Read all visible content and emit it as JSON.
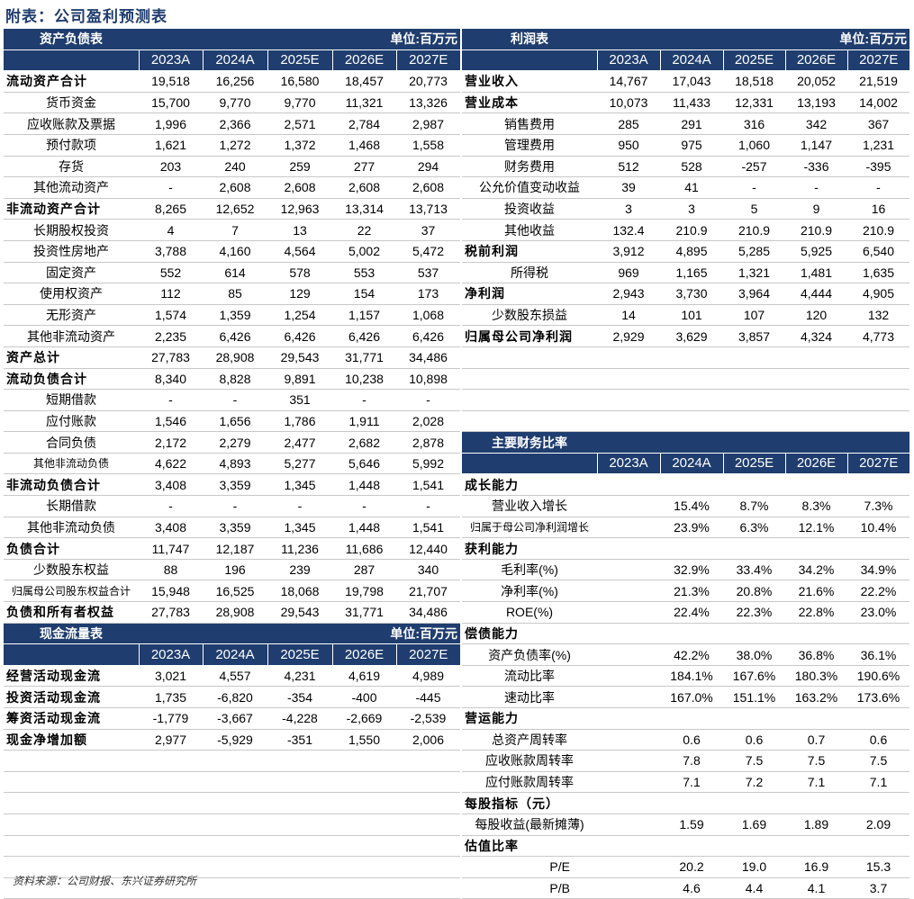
{
  "title": "附表：公司盈利预测表",
  "source": "资料来源：公司财报、东兴证券研究所",
  "balance": {
    "header": "资产负债表",
    "unit": "单位:百万元",
    "years": [
      "2023A",
      "2024A",
      "2025E",
      "2026E",
      "2027E"
    ],
    "rows": [
      {
        "label": "流动资产合计",
        "style": "bold",
        "values": [
          "19,518",
          "16,256",
          "16,580",
          "18,457",
          "20,773"
        ]
      },
      {
        "label": "货币资金",
        "style": "sub",
        "values": [
          "15,700",
          "9,770",
          "9,770",
          "11,321",
          "13,326"
        ]
      },
      {
        "label": "应收账款及票据",
        "style": "sub",
        "values": [
          "1,996",
          "2,366",
          "2,571",
          "2,784",
          "2,987"
        ]
      },
      {
        "label": "预付款项",
        "style": "sub",
        "values": [
          "1,621",
          "1,272",
          "1,372",
          "1,468",
          "1,558"
        ]
      },
      {
        "label": "存货",
        "style": "sub",
        "values": [
          "203",
          "240",
          "259",
          "277",
          "294"
        ]
      },
      {
        "label": "其他流动资产",
        "style": "sub",
        "values": [
          "-",
          "2,608",
          "2,608",
          "2,608",
          "2,608"
        ]
      },
      {
        "label": "非流动资产合计",
        "style": "bold",
        "values": [
          "8,265",
          "12,652",
          "12,963",
          "13,314",
          "13,713"
        ]
      },
      {
        "label": "长期股权投资",
        "style": "sub",
        "values": [
          "4",
          "7",
          "13",
          "22",
          "37"
        ]
      },
      {
        "label": "投资性房地产",
        "style": "sub",
        "values": [
          "3,788",
          "4,160",
          "4,564",
          "5,002",
          "5,472"
        ]
      },
      {
        "label": "固定资产",
        "style": "sub",
        "values": [
          "552",
          "614",
          "578",
          "553",
          "537"
        ]
      },
      {
        "label": "使用权资产",
        "style": "sub",
        "values": [
          "112",
          "85",
          "129",
          "154",
          "173"
        ]
      },
      {
        "label": "无形资产",
        "style": "sub",
        "values": [
          "1,574",
          "1,359",
          "1,254",
          "1,157",
          "1,068"
        ]
      },
      {
        "label": "其他非流动资产",
        "style": "sub",
        "values": [
          "2,235",
          "6,426",
          "6,426",
          "6,426",
          "6,426"
        ]
      },
      {
        "label": "资产总计",
        "style": "bold",
        "values": [
          "27,783",
          "28,908",
          "29,543",
          "31,771",
          "34,486"
        ]
      },
      {
        "label": "流动负债合计",
        "style": "bold",
        "values": [
          "8,340",
          "8,828",
          "9,891",
          "10,238",
          "10,898"
        ]
      },
      {
        "label": "短期借款",
        "style": "sub",
        "values": [
          "-",
          "-",
          "351",
          "-",
          "-"
        ]
      },
      {
        "label": "应付账款",
        "style": "sub",
        "values": [
          "1,546",
          "1,656",
          "1,786",
          "1,911",
          "2,028"
        ]
      },
      {
        "label": "合同负债",
        "style": "sub",
        "values": [
          "2,172",
          "2,279",
          "2,477",
          "2,682",
          "2,878"
        ]
      },
      {
        "label": "其他非流动负债",
        "style": "sub small",
        "values": [
          "4,622",
          "4,893",
          "5,277",
          "5,646",
          "5,992"
        ]
      },
      {
        "label": "非流动负债合计",
        "style": "bold",
        "values": [
          "3,408",
          "3,359",
          "1,345",
          "1,448",
          "1,541"
        ]
      },
      {
        "label": "长期借款",
        "style": "sub",
        "values": [
          "-",
          "-",
          "-",
          "-",
          "-"
        ]
      },
      {
        "label": "其他非流动负债",
        "style": "sub",
        "values": [
          "3,408",
          "3,359",
          "1,345",
          "1,448",
          "1,541"
        ]
      },
      {
        "label": "负债合计",
        "style": "bold",
        "values": [
          "11,747",
          "12,187",
          "11,236",
          "11,686",
          "12,440"
        ]
      },
      {
        "label": "少数股东权益",
        "style": "sub",
        "values": [
          "88",
          "196",
          "239",
          "287",
          "340"
        ]
      },
      {
        "label": "归属母公司股东权益合计",
        "style": "sub small",
        "values": [
          "15,948",
          "16,525",
          "18,068",
          "19,798",
          "21,707"
        ]
      },
      {
        "label": "负债和所有者权益",
        "style": "bold",
        "values": [
          "27,783",
          "28,908",
          "29,543",
          "31,771",
          "34,486"
        ]
      }
    ]
  },
  "cashflow": {
    "header": "现金流量表",
    "unit": "单位:百万元",
    "years": [
      "2023A",
      "2024A",
      "2025E",
      "2026E",
      "2027E"
    ],
    "rows": [
      {
        "label": "经营活动现金流",
        "style": "bold",
        "values": [
          "3,021",
          "4,557",
          "4,231",
          "4,619",
          "4,989"
        ]
      },
      {
        "label": "投资活动现金流",
        "style": "bold",
        "values": [
          "1,735",
          "-6,820",
          "-354",
          "-400",
          "-445"
        ]
      },
      {
        "label": "筹资活动现金流",
        "style": "bold",
        "values": [
          "-1,779",
          "-3,667",
          "-4,228",
          "-2,669",
          "-2,539"
        ]
      },
      {
        "label": "现金净增加额",
        "style": "bold",
        "values": [
          "2,977",
          "-5,929",
          "-351",
          "1,550",
          "2,006"
        ]
      }
    ]
  },
  "income": {
    "header": "利润表",
    "unit": "单位:百万元",
    "years": [
      "2023A",
      "2024A",
      "2025E",
      "2026E",
      "2027E"
    ],
    "rows": [
      {
        "label": "营业收入",
        "style": "bold",
        "values": [
          "14,767",
          "17,043",
          "18,518",
          "20,052",
          "21,519"
        ]
      },
      {
        "label": "营业成本",
        "style": "bold",
        "values": [
          "10,073",
          "11,433",
          "12,331",
          "13,193",
          "14,002"
        ]
      },
      {
        "label": "销售费用",
        "style": "sub",
        "values": [
          "285",
          "291",
          "316",
          "342",
          "367"
        ]
      },
      {
        "label": "管理费用",
        "style": "sub",
        "values": [
          "950",
          "975",
          "1,060",
          "1,147",
          "1,231"
        ]
      },
      {
        "label": "财务费用",
        "style": "sub",
        "values": [
          "512",
          "528",
          "-257",
          "-336",
          "-395"
        ]
      },
      {
        "label": "公允价值变动收益",
        "style": "sub",
        "values": [
          "39",
          "41",
          "-",
          "-",
          "-"
        ]
      },
      {
        "label": "投资收益",
        "style": "sub",
        "values": [
          "3",
          "3",
          "5",
          "9",
          "16"
        ]
      },
      {
        "label": "其他收益",
        "style": "sub",
        "values": [
          "132.4",
          "210.9",
          "210.9",
          "210.9",
          "210.9"
        ]
      },
      {
        "label": "税前利润",
        "style": "bold",
        "values": [
          "3,912",
          "4,895",
          "5,285",
          "5,925",
          "6,540"
        ]
      },
      {
        "label": "所得税",
        "style": "sub",
        "values": [
          "969",
          "1,165",
          "1,321",
          "1,481",
          "1,635"
        ]
      },
      {
        "label": "净利润",
        "style": "bold",
        "values": [
          "2,943",
          "3,730",
          "3,964",
          "4,444",
          "4,905"
        ]
      },
      {
        "label": "少数股东损益",
        "style": "sub",
        "values": [
          "14",
          "101",
          "107",
          "120",
          "132"
        ]
      },
      {
        "label": "归属母公司净利润",
        "style": "bold",
        "values": [
          "2,929",
          "3,629",
          "3,857",
          "4,324",
          "4,773"
        ]
      }
    ]
  },
  "ratios": {
    "header": "主要财务比率",
    "years": [
      "2023A",
      "2024A",
      "2025E",
      "2026E",
      "2027E"
    ],
    "rows": [
      {
        "label": "成长能力",
        "style": "bold",
        "values": [
          "",
          "",
          "",
          "",
          ""
        ]
      },
      {
        "label": "营业收入增长",
        "style": "sub",
        "values": [
          "",
          "15.4%",
          "8.7%",
          "8.3%",
          "7.3%"
        ]
      },
      {
        "label": "归属于母公司净利润增长",
        "style": "sub small",
        "values": [
          "",
          "23.9%",
          "6.3%",
          "12.1%",
          "10.4%"
        ]
      },
      {
        "label": "获利能力",
        "style": "bold",
        "values": [
          "",
          "",
          "",
          "",
          ""
        ]
      },
      {
        "label": "毛利率(%)",
        "style": "sub",
        "values": [
          "",
          "32.9%",
          "33.4%",
          "34.2%",
          "34.9%"
        ]
      },
      {
        "label": "净利率(%)",
        "style": "sub",
        "values": [
          "",
          "21.3%",
          "20.8%",
          "21.6%",
          "22.2%"
        ]
      },
      {
        "label": "ROE(%)",
        "style": "sub",
        "values": [
          "",
          "22.4%",
          "22.3%",
          "22.8%",
          "23.0%"
        ]
      },
      {
        "label": "偿债能力",
        "style": "bold",
        "values": [
          "",
          "",
          "",
          "",
          ""
        ]
      },
      {
        "label": "资产负债率(%)",
        "style": "sub",
        "values": [
          "",
          "42.2%",
          "38.0%",
          "36.8%",
          "36.1%"
        ]
      },
      {
        "label": "流动比率",
        "style": "sub",
        "values": [
          "",
          "184.1%",
          "167.6%",
          "180.3%",
          "190.6%"
        ]
      },
      {
        "label": "速动比率",
        "style": "sub",
        "values": [
          "",
          "167.0%",
          "151.1%",
          "163.2%",
          "173.6%"
        ]
      },
      {
        "label": "营运能力",
        "style": "bold",
        "values": [
          "",
          "",
          "",
          "",
          ""
        ]
      },
      {
        "label": "总资产周转率",
        "style": "sub",
        "values": [
          "",
          "0.6",
          "0.6",
          "0.7",
          "0.6"
        ]
      },
      {
        "label": "应收账款周转率",
        "style": "sub",
        "values": [
          "",
          "7.8",
          "7.5",
          "7.5",
          "7.5"
        ]
      },
      {
        "label": "应付账款周转率",
        "style": "sub",
        "values": [
          "",
          "7.1",
          "7.2",
          "7.1",
          "7.1"
        ]
      },
      {
        "label": "每股指标（元）",
        "style": "bold",
        "values": [
          "",
          "",
          "",
          "",
          ""
        ]
      },
      {
        "label": "每股收益(最新摊薄)",
        "style": "sub",
        "values": [
          "",
          "1.59",
          "1.69",
          "1.89",
          "2.09"
        ]
      },
      {
        "label": "估值比率",
        "style": "bold",
        "values": [
          "",
          "",
          "",
          "",
          ""
        ]
      },
      {
        "label": "P/E",
        "style": "right",
        "values": [
          "",
          "20.2",
          "19.0",
          "16.9",
          "15.3"
        ]
      },
      {
        "label": "P/B",
        "style": "right",
        "values": [
          "",
          "4.6",
          "4.4",
          "4.1",
          "3.7"
        ]
      }
    ]
  }
}
